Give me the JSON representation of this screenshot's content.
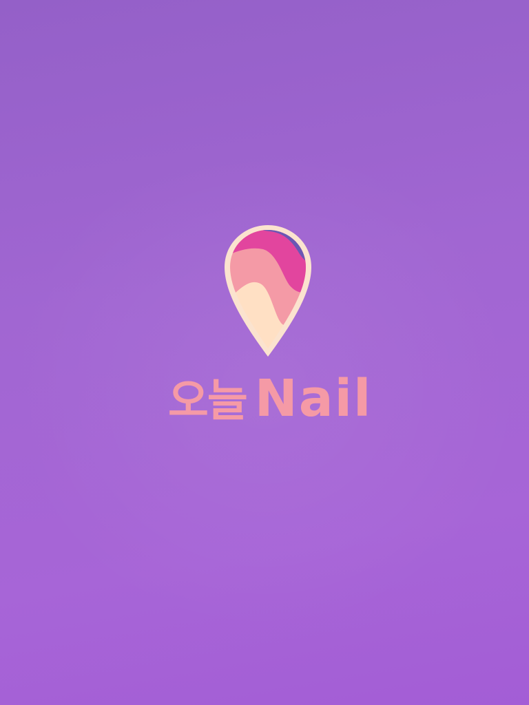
{
  "app": {
    "name_ko": "오늘",
    "name_en": "Nail"
  },
  "logo": {
    "icon": "nail-location-pin-icon"
  },
  "colors": {
    "background": "#a166d2",
    "wordmark": "#f59aa6",
    "pin_outline": "#fbe3cf",
    "pin_base": "#ffe0c4",
    "wave_pink": "#f49aa6",
    "wave_magenta": "#e2459e",
    "wave_purple": "#6a58b4"
  }
}
